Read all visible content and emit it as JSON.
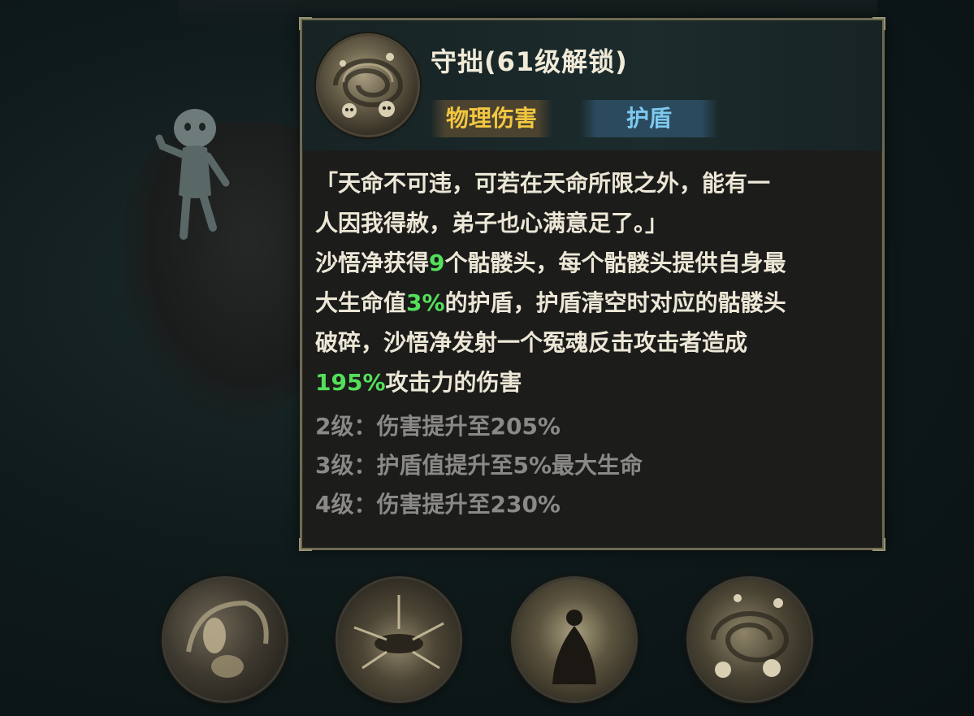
{
  "skill": {
    "title": "守拙(61级解锁)",
    "tags": {
      "physical_damage": "物理伤害",
      "shield": "护盾"
    },
    "quote_line1": "「天命不可违，可若在天命所限之外，能有一",
    "quote_line2": "人因我得赦，弟子也心满意足了。」",
    "desc": {
      "p1a": "沙悟净获得",
      "skull_count": "9",
      "p1b": "个骷髅头，每个骷髅头提供自身最",
      "p2a": "大生命值",
      "shield_pct": "3%",
      "p2b": "的护盾，护盾清空时对应的骷髅头",
      "p3": "破碎，沙悟净发射一个冤魂反击攻击者造成",
      "damage_pct": "195%",
      "p4b": "攻击力的伤害"
    },
    "levels": [
      "2级：伤害提升至205%",
      "3级：护盾值提升至5%最大生命",
      "4级：伤害提升至230%"
    ]
  },
  "colors": {
    "highlight_green": "#54e05a",
    "tag_gold": "#f2c640",
    "tag_blue": "#7ec8ee",
    "panel_border": "#6e6a52"
  },
  "skill_row": {
    "icons": [
      "skill-icon-1",
      "skill-icon-2",
      "skill-icon-3",
      "skill-icon-4"
    ]
  }
}
